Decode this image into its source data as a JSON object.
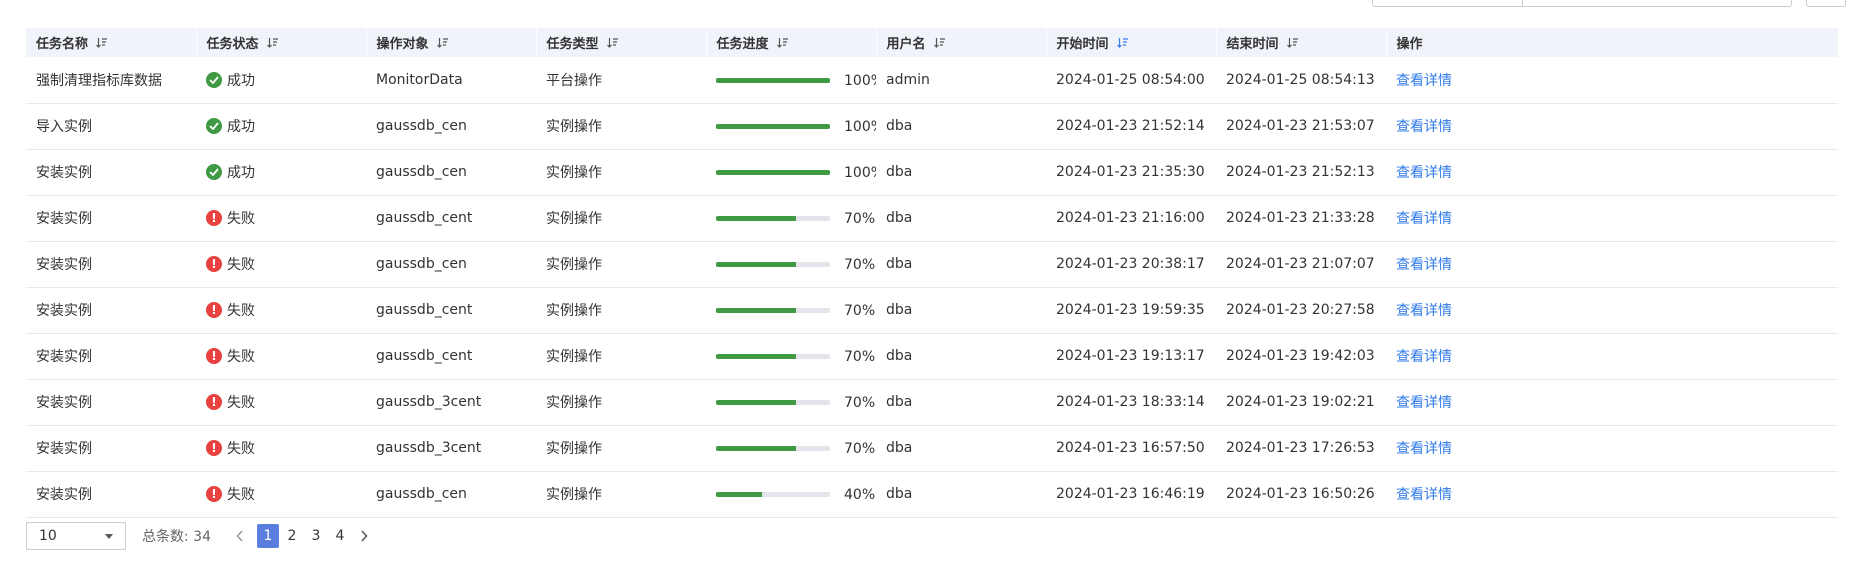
{
  "table": {
    "columns": [
      {
        "label": "任务名称",
        "sort_active": false
      },
      {
        "label": "任务状态",
        "sort_active": false
      },
      {
        "label": "操作对象",
        "sort_active": false
      },
      {
        "label": "任务类型",
        "sort_active": false
      },
      {
        "label": "任务进度",
        "sort_active": false
      },
      {
        "label": "用户名",
        "sort_active": false
      },
      {
        "label": "开始时间",
        "sort_active": true
      },
      {
        "label": "结束时间",
        "sort_active": false
      },
      {
        "label": "操作",
        "sort_active": null
      }
    ],
    "rows": [
      {
        "name": "强制清理指标库数据",
        "status": "成功",
        "status_type": "success",
        "target": "MonitorData",
        "type": "平台操作",
        "progress": 100,
        "progress_text": "100%",
        "user": "admin",
        "start": "2024-01-25 08:54:00",
        "end": "2024-01-25 08:54:13",
        "action": "查看详情"
      },
      {
        "name": "导入实例",
        "status": "成功",
        "status_type": "success",
        "target": "gaussdb_cen",
        "type": "实例操作",
        "progress": 100,
        "progress_text": "100%",
        "user": "dba",
        "start": "2024-01-23 21:52:14",
        "end": "2024-01-23 21:53:07",
        "action": "查看详情"
      },
      {
        "name": "安装实例",
        "status": "成功",
        "status_type": "success",
        "target": "gaussdb_cen",
        "type": "实例操作",
        "progress": 100,
        "progress_text": "100%",
        "user": "dba",
        "start": "2024-01-23 21:35:30",
        "end": "2024-01-23 21:52:13",
        "action": "查看详情"
      },
      {
        "name": "安装实例",
        "status": "失败",
        "status_type": "fail",
        "target": "gaussdb_cent",
        "type": "实例操作",
        "progress": 70,
        "progress_text": "70%",
        "user": "dba",
        "start": "2024-01-23 21:16:00",
        "end": "2024-01-23 21:33:28",
        "action": "查看详情"
      },
      {
        "name": "安装实例",
        "status": "失败",
        "status_type": "fail",
        "target": "gaussdb_cen",
        "type": "实例操作",
        "progress": 70,
        "progress_text": "70%",
        "user": "dba",
        "start": "2024-01-23 20:38:17",
        "end": "2024-01-23 21:07:07",
        "action": "查看详情"
      },
      {
        "name": "安装实例",
        "status": "失败",
        "status_type": "fail",
        "target": "gaussdb_cent",
        "type": "实例操作",
        "progress": 70,
        "progress_text": "70%",
        "user": "dba",
        "start": "2024-01-23 19:59:35",
        "end": "2024-01-23 20:27:58",
        "action": "查看详情"
      },
      {
        "name": "安装实例",
        "status": "失败",
        "status_type": "fail",
        "target": "gaussdb_cent",
        "type": "实例操作",
        "progress": 70,
        "progress_text": "70%",
        "user": "dba",
        "start": "2024-01-23 19:13:17",
        "end": "2024-01-23 19:42:03",
        "action": "查看详情"
      },
      {
        "name": "安装实例",
        "status": "失败",
        "status_type": "fail",
        "target": "gaussdb_3cent",
        "type": "实例操作",
        "progress": 70,
        "progress_text": "70%",
        "user": "dba",
        "start": "2024-01-23 18:33:14",
        "end": "2024-01-23 19:02:21",
        "action": "查看详情"
      },
      {
        "name": "安装实例",
        "status": "失败",
        "status_type": "fail",
        "target": "gaussdb_3cent",
        "type": "实例操作",
        "progress": 70,
        "progress_text": "70%",
        "user": "dba",
        "start": "2024-01-23 16:57:50",
        "end": "2024-01-23 17:26:53",
        "action": "查看详情"
      },
      {
        "name": "安装实例",
        "status": "失败",
        "status_type": "fail",
        "target": "gaussdb_cen",
        "type": "实例操作",
        "progress": 40,
        "progress_text": "40%",
        "user": "dba",
        "start": "2024-01-23 16:46:19",
        "end": "2024-01-23 16:50:26",
        "action": "查看详情"
      }
    ]
  },
  "pagination": {
    "page_size": "10",
    "total_label": "总条数:",
    "total": "34",
    "pages": [
      "1",
      "2",
      "3",
      "4"
    ],
    "current": "1",
    "icons": {
      "prev": "chevron-left-icon",
      "next": "chevron-right-icon",
      "dropdown": "caret-down-icon"
    }
  },
  "colors": {
    "header_bg": "#f0f3fa",
    "success": "#3f9a43",
    "fail": "#e8413f",
    "link": "#2f7bea",
    "active_page": "#5b7de0",
    "sort_active": "#3a7bf0"
  }
}
